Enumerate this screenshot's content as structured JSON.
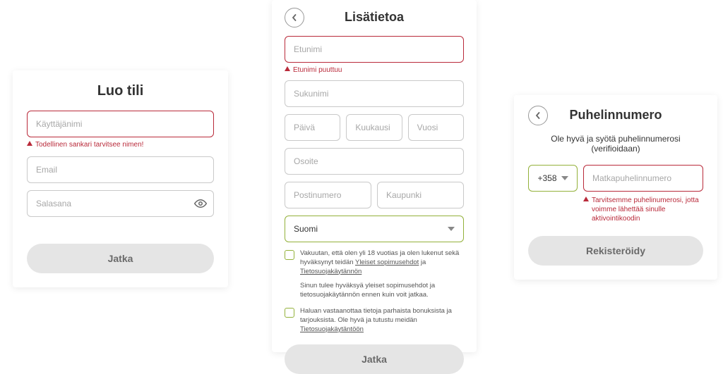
{
  "panel1": {
    "title": "Luo tili",
    "username_placeholder": "Käyttäjänimi",
    "username_error": "Todellinen sankari tarvitsee nimen!",
    "email_placeholder": "Email",
    "password_placeholder": "Salasana",
    "continue": "Jatka"
  },
  "panel2": {
    "title": "Lisätietoa",
    "firstname_placeholder": "Etunimi",
    "firstname_error": "Etunimi puuttuu",
    "lastname_placeholder": "Sukunimi",
    "day_placeholder": "Päivä",
    "month_placeholder": "Kuukausi",
    "year_placeholder": "Vuosi",
    "address_placeholder": "Osoite",
    "postal_placeholder": "Postinumero",
    "city_placeholder": "Kaupunki",
    "country_value": "Suomi",
    "terms_prefix": "Vakuutan, että olen yli 18 vuotias ja olen lukenut sekä hyväksynyt teidän ",
    "terms_link1": "Yleiset sopimusehdot",
    "terms_mid": " ja ",
    "terms_link2": "Tietosuojakäytännön",
    "terms_help": "Sinun tulee hyväksyä yleiset sopimusehdot ja tietosuojakäytännön ennen kuin voit jatkaa.",
    "marketing_prefix": "Haluan vastaanottaa tietoja parhaista bonuksista ja tarjouksista. Ole hyvä ja tutustu meidän ",
    "marketing_link": "Tietosuojakäytäntöön",
    "continue": "Jatka"
  },
  "panel3": {
    "title": "Puhelinnumero",
    "subtitle": "Ole hyvä ja syötä puhelinnumerosi (verifioidaan)",
    "prefix": "+358",
    "phone_placeholder": "Matkapuhelinnumero",
    "phone_error": "Tarvitsemme puhelinumerosi, jotta voimme lähettää sinulle aktivointikoodin",
    "register": "Rekisteröidy"
  }
}
